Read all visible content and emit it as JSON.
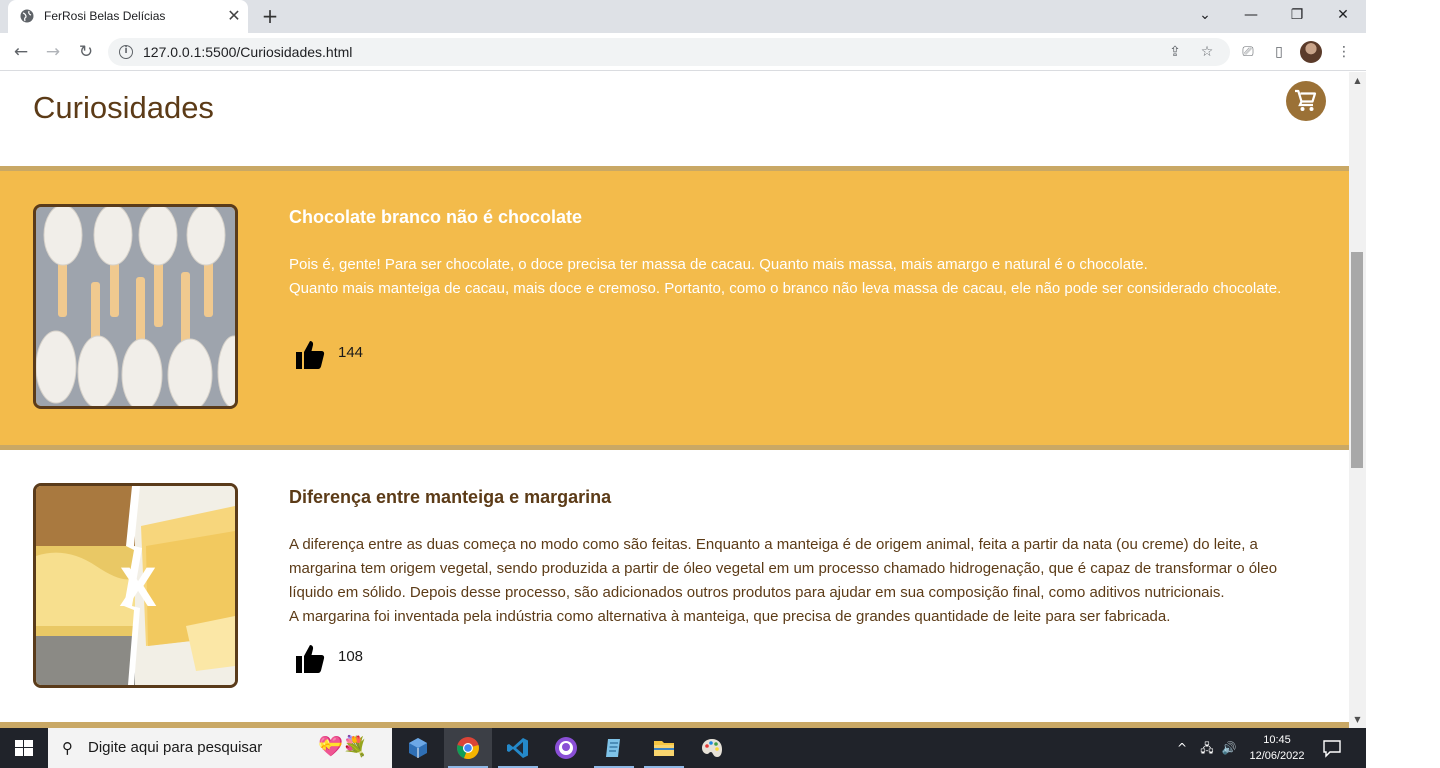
{
  "browser": {
    "tab_title": "FerRosi Belas Delícias",
    "tab_close": "✕",
    "new_tab": "+",
    "url": "127.0.0.1:5500/Curiosidades.html",
    "window_controls": {
      "dropdown": "⌄",
      "minimize": "—",
      "restore": "❐",
      "close": "✕"
    },
    "nav": {
      "back": "←",
      "forward": "→",
      "reload": "↻"
    },
    "info_icon_glyph": "i",
    "omnibox_icons": {
      "share": "⇪",
      "star": "☆"
    },
    "toolbar_icons": {
      "cast": "⎚",
      "sidepanel": "▯",
      "menu": "⋮"
    }
  },
  "page": {
    "title": "Curiosidades",
    "cards": [
      {
        "title": "Chocolate branco não é chocolate",
        "paragraphs": [
          "Pois é, gente! Para ser chocolate, o doce precisa ter massa de cacau. Quanto mais massa, mais amargo e natural é o chocolate.",
          "Quanto mais manteiga de cacau, mais doce e cremoso. Portanto, como o branco não leva massa de cacau, ele não pode ser considerado chocolate."
        ],
        "likes": "144",
        "background": "#f3bb4b",
        "text_color": "#ffffff"
      },
      {
        "title": "Diferença entre manteiga e margarina",
        "paragraphs": [
          "A diferença entre as duas começa no modo como são feitas. Enquanto a manteiga é de origem animal, feita a partir da nata (ou creme) do leite, a margarina tem origem vegetal, sendo produzida a partir de óleo vegetal em um processo chamado hidrogenação, que é capaz de transformar o óleo líquido em sólido. Depois desse processo, são adicionados outros produtos para ajudar em sua composição final, como aditivos nutricionais.",
          "A margarina foi inventada pela indústria como alternativa à manteiga, que precisa de grandes quantidade de leite para ser fabricada."
        ],
        "likes": "108",
        "background": "#ffffff",
        "text_color": "#5c3b17",
        "image_overlay_text": "X"
      }
    ]
  },
  "scrollbar": {
    "up": "▲",
    "down": "▼"
  },
  "taskbar": {
    "search_placeholder": "Digite aqui para pesquisar",
    "apps": [
      "task-view",
      "virtualbox",
      "chrome",
      "vscode",
      "github-desktop",
      "notepad",
      "file-explorer",
      "paint"
    ],
    "tray": {
      "chevron": "^",
      "network": "🖧",
      "volume": "🔊"
    },
    "time": "10:45",
    "date": "12/06/2022"
  },
  "colors": {
    "brown": "#5c3b17",
    "accent": "#f3bb4b",
    "divider": "#c9a865",
    "cart": "#9b7136"
  }
}
